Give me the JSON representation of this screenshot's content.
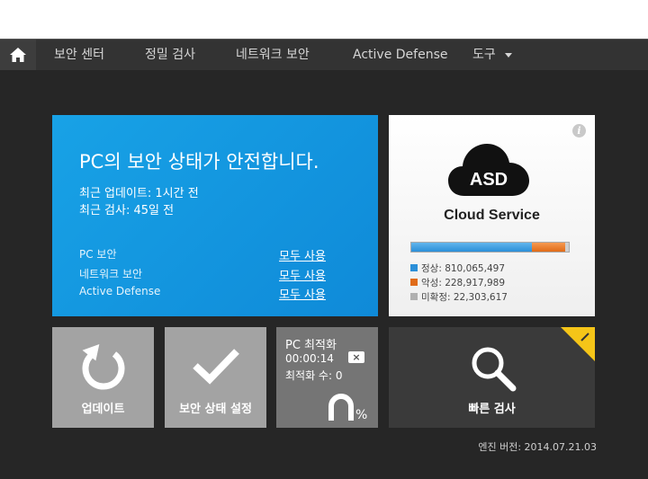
{
  "nav": {
    "items": [
      {
        "label": "보안 센터"
      },
      {
        "label": "정밀 검사"
      },
      {
        "label": "네트워크 보안"
      },
      {
        "label": "Active Defense"
      },
      {
        "label": "도구"
      }
    ]
  },
  "status": {
    "title": "PC의 보안 상태가 안전합니다.",
    "last_update": "최근 업데이트: 1시간 전",
    "last_scan": "최근 검사: 45일 전",
    "features": [
      {
        "name": "PC 보안",
        "link": "모두 사용"
      },
      {
        "name": "네트워크 보안",
        "link": "모두 사용"
      },
      {
        "name": "Active Defense",
        "link": "모두 사용"
      }
    ],
    "color": "#1399e0"
  },
  "cloud": {
    "logo_text": "ASD",
    "label": "Cloud Service",
    "info_icon": "i",
    "stats": [
      {
        "label": "정상: 810,065,497",
        "color": "#2b8fd8",
        "fraction": 0.765
      },
      {
        "label": "악성: 228,917,989",
        "color": "#e06b18",
        "fraction": 0.214
      },
      {
        "label": "미확정: 22,303,617",
        "color": "#b0b0b0",
        "fraction": 0.021
      }
    ]
  },
  "tiles": {
    "update": {
      "label": "업데이트",
      "icon": "refresh-icon"
    },
    "setting": {
      "label": "보안 상태 설정",
      "icon": "checkmark-icon"
    },
    "optimize": {
      "title": "PC 최적화",
      "time": "00:00:14",
      "count": "최적화 수: 0",
      "close": "×",
      "percent_sign": "%"
    },
    "scan": {
      "label": "빠른 검사",
      "icon": "magnifier-icon",
      "corner_color": "#f5c518"
    }
  },
  "footer": {
    "version": "엔진 버전: 2014.07.21.03"
  }
}
